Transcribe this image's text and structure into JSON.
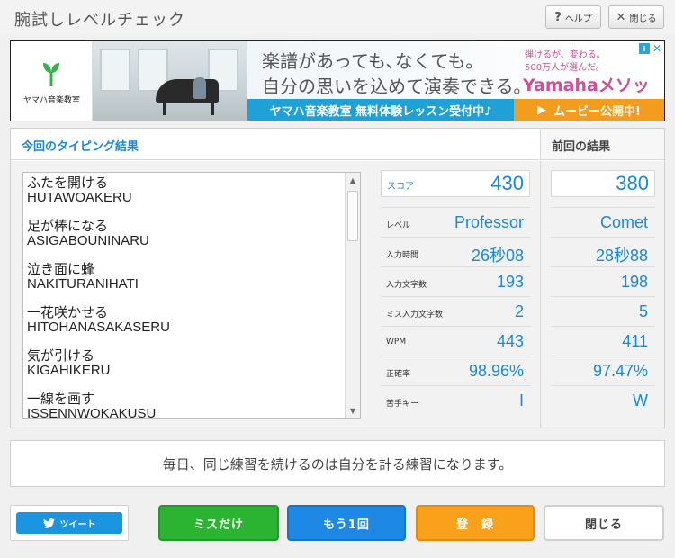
{
  "window": {
    "title": "腕試しレベルチェック",
    "help_label": "ヘルプ",
    "close_label": "閉じる"
  },
  "ad": {
    "brand": "ヤマハ音楽教室",
    "copy_line1": "楽譜があっても､なくても｡",
    "copy_line2": "自分の思いを込めて演奏できる｡",
    "side_line1": "弾けるが、変わる。",
    "side_line2": "500万人が選んだ。",
    "method": "Yamahaメソッド",
    "cta_left": "ヤマハ音楽教室 無料体験レッスン受付中♪",
    "cta_right": "ムービー公開中!",
    "info_icon": "i",
    "close_icon": "✕"
  },
  "results": {
    "current_heading": "今回のタイピング結果",
    "previous_heading": "前回の結果",
    "words": [
      {
        "kana": "ふたを開ける",
        "romaji": "HUTAWOAKERU"
      },
      {
        "kana": "足が棒になる",
        "romaji": "ASIGABOUNINARU"
      },
      {
        "kana": "泣き面に蜂",
        "romaji": "NAKITURANIHATI"
      },
      {
        "kana": "一花咲かせる",
        "romaji": "HITOHANASAKASERU"
      },
      {
        "kana": "気が引ける",
        "romaji": "KIGAHIKERU"
      },
      {
        "kana": "一線を画す",
        "romaji": "ISSENNWOKAKUSU"
      }
    ],
    "score": {
      "label": "スコア",
      "current": "430",
      "previous": "380"
    },
    "stats": [
      {
        "label": "レベル",
        "current": "Professor",
        "previous": "Comet"
      },
      {
        "label": "入力時間",
        "current": "26秒08",
        "previous": "28秒88"
      },
      {
        "label": "入力文字数",
        "current": "193",
        "previous": "198"
      },
      {
        "label": "ミス入力文字数",
        "current": "2",
        "previous": "5"
      },
      {
        "label": "WPM",
        "current": "443",
        "previous": "411"
      },
      {
        "label": "正確率",
        "current": "98.96%",
        "previous": "97.47%"
      },
      {
        "label": "苦手キー",
        "current": "I",
        "previous": "W"
      }
    ]
  },
  "message": "毎日、同じ練習を続けるのは自分を計る練習になります。",
  "buttons": {
    "tweet": "ツイート",
    "miss_only": "ミスだけ",
    "again": "もう1回",
    "register": "登　録",
    "close": "閉じる"
  },
  "colors": {
    "accent_blue": "#1a87d9",
    "green": "#2ab432",
    "blue": "#1e88e5",
    "orange": "#f9a11b",
    "twitter": "#1b95e0"
  }
}
